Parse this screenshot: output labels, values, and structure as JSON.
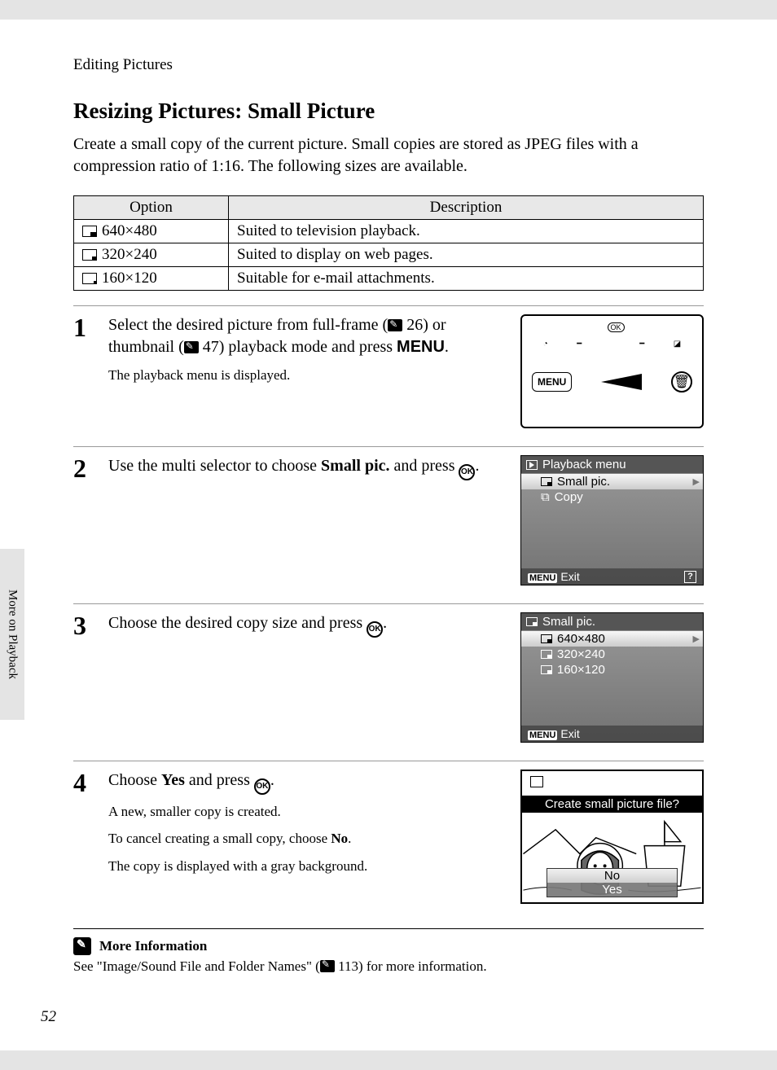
{
  "breadcrumb": "Editing Pictures",
  "heading": "Resizing Pictures: Small Picture",
  "intro": "Create a small copy of the current picture. Small copies are stored as JPEG files with a compression ratio of 1:16. The following sizes are available.",
  "table": {
    "headers": {
      "option": "Option",
      "description": "Description"
    },
    "rows": [
      {
        "option": "640×480",
        "description": "Suited to television playback."
      },
      {
        "option": "320×240",
        "description": "Suited to display on web pages."
      },
      {
        "option": "160×120",
        "description": "Suitable for e-mail attachments."
      }
    ]
  },
  "steps": {
    "s1": {
      "num": "1",
      "text_a": "Select the desired picture from full-frame (",
      "ref_a": "26",
      "text_b": ") or thumbnail (",
      "ref_b": "47",
      "text_c": ") playback mode and press ",
      "menu": "MENU",
      "text_d": ".",
      "sub": "The playback menu is displayed.",
      "diagram": {
        "ok": "OK",
        "menu_btn": "MENU",
        "trash": "🗑"
      }
    },
    "s2": {
      "num": "2",
      "text_a": "Use the multi selector to choose ",
      "bold": "Small pic.",
      "text_b": " and press ",
      "ok": "OK",
      "text_c": ".",
      "lcd": {
        "title": "Playback menu",
        "item_selected": "Small pic.",
        "item2": "Copy",
        "exit_menu": "MENU",
        "exit": "Exit",
        "help": "?"
      }
    },
    "s3": {
      "num": "3",
      "text_a": "Choose the desired copy size and press ",
      "ok": "OK",
      "text_b": ".",
      "lcd": {
        "title": "Small pic.",
        "item_selected": "640×480",
        "item2": "320×240",
        "item3": "160×120",
        "exit_menu": "MENU",
        "exit": "Exit"
      }
    },
    "s4": {
      "num": "4",
      "text_a": "Choose ",
      "bold1": "Yes",
      "text_b": " and press ",
      "ok": "OK",
      "text_c": ".",
      "sub1": "A new, smaller copy is created.",
      "sub2_a": "To cancel creating a small copy, choose ",
      "sub2_b": "No",
      "sub2_c": ".",
      "sub3": "The copy is displayed with a gray background.",
      "dialog": {
        "question": "Create small picture file?",
        "opt_selected": "No",
        "opt2": "Yes"
      }
    }
  },
  "side_tab": "More on Playback",
  "more_info": {
    "title": "More Information",
    "text_a": "See \"Image/Sound File and Folder Names\" (",
    "ref": "113",
    "text_b": ") for more information."
  },
  "page_number": "52"
}
